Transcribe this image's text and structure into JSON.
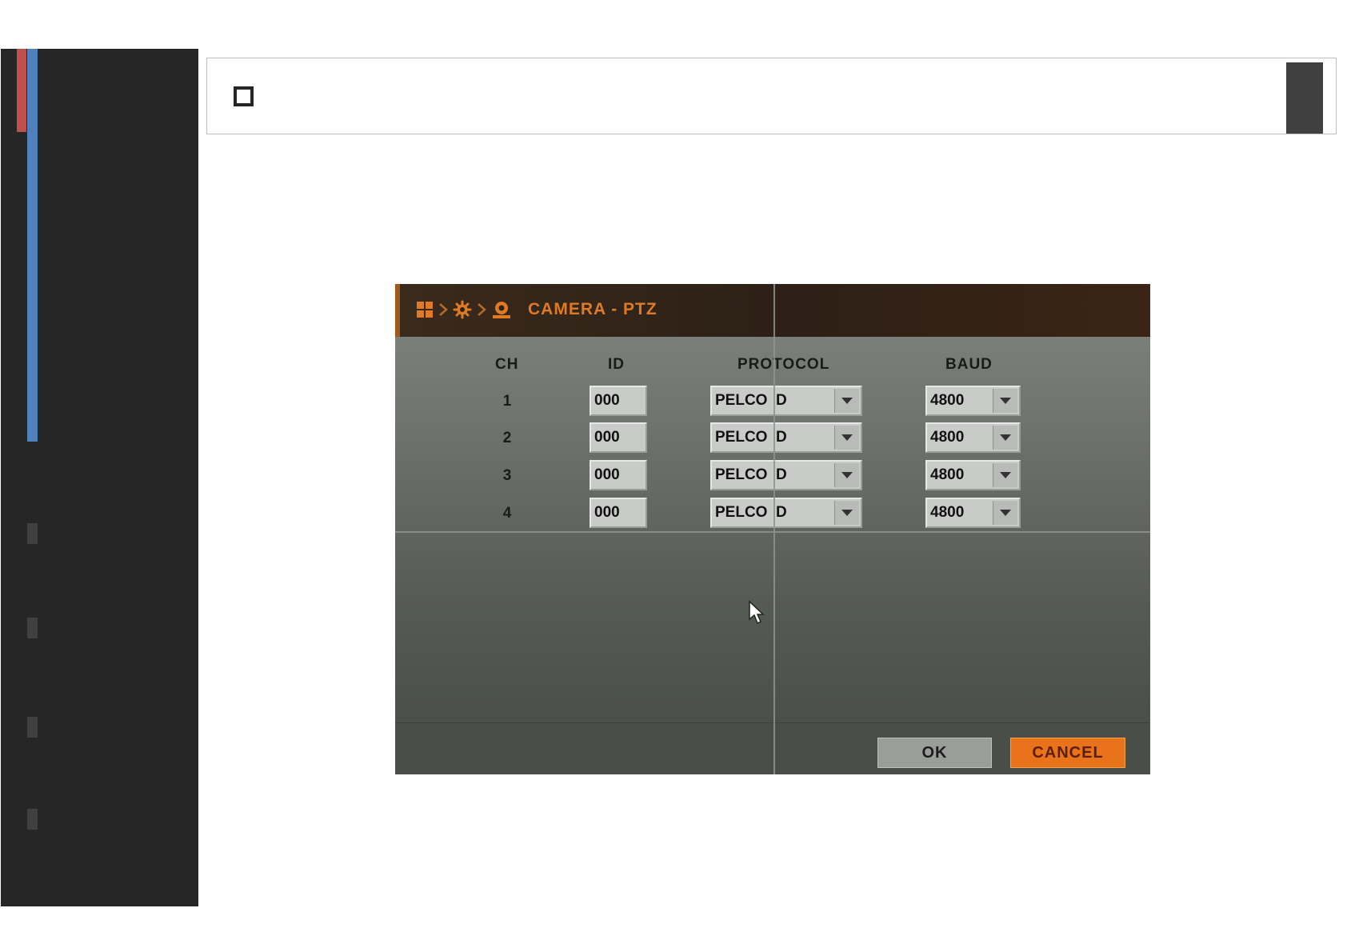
{
  "dialog": {
    "title": "CAMERA - PTZ",
    "breadcrumb_icons": [
      "grid-icon",
      "chevron-right-icon",
      "gear-icon",
      "chevron-right-icon",
      "camera-icon"
    ],
    "columns": {
      "ch": "CH",
      "id": "ID",
      "protocol": "PROTOCOL",
      "baud": "BAUD"
    },
    "rows": [
      {
        "ch": "1",
        "id": "000",
        "protocol": "PELCO  D",
        "baud": "4800"
      },
      {
        "ch": "2",
        "id": "000",
        "protocol": "PELCO  D",
        "baud": "4800"
      },
      {
        "ch": "3",
        "id": "000",
        "protocol": "PELCO  D",
        "baud": "4800"
      },
      {
        "ch": "4",
        "id": "000",
        "protocol": "PELCO  D",
        "baud": "4800"
      }
    ],
    "ok_label": "OK",
    "cancel_label": "CANCEL"
  },
  "colors": {
    "accent": "#e07a25",
    "cancel_button": "#e8731a",
    "sidebar": "#262626",
    "sidebar_red": "#c0504d",
    "sidebar_blue": "#4f81bd"
  }
}
